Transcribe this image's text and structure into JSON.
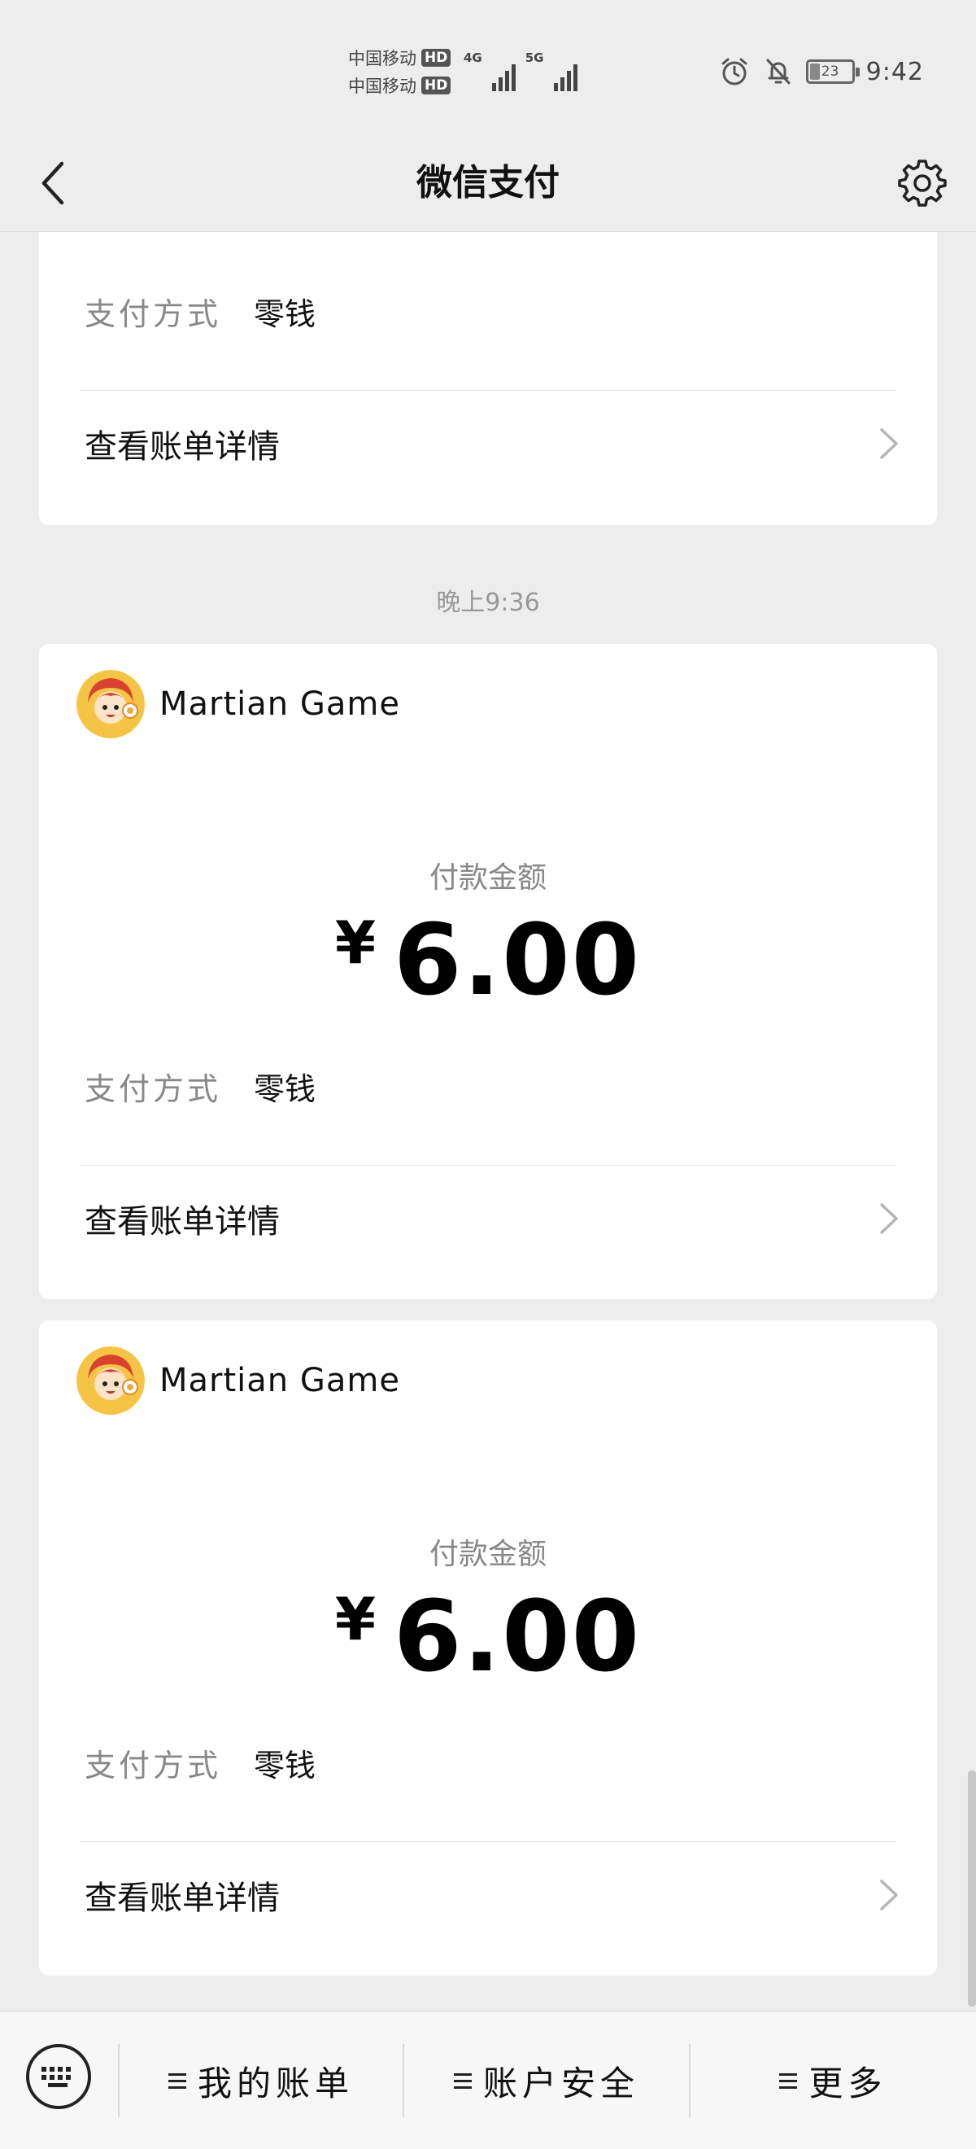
{
  "status_bar": {
    "carrier_1": "中国移动",
    "carrier_2": "中国移动",
    "hd_badge": "HD",
    "network_1": "4G",
    "network_2": "5G",
    "battery": "23",
    "time": "9:42",
    "icons": [
      "alarm-icon",
      "mute-bell-icon",
      "battery-icon"
    ]
  },
  "nav": {
    "title": "微信支付",
    "back_icon": "chevron-left-icon",
    "settings_icon": "gear-icon"
  },
  "cards": [
    {
      "method_label": "支付方式",
      "method_value": "零钱",
      "detail_label": "查看账单详情"
    },
    {
      "merchant": "Martian Game",
      "amount_label": "付款金额",
      "currency": "¥",
      "amount": "6.00",
      "method_label": "支付方式",
      "method_value": "零钱",
      "detail_label": "查看账单详情"
    },
    {
      "merchant": "Martian Game",
      "amount_label": "付款金额",
      "currency": "¥",
      "amount": "6.00",
      "method_label": "支付方式",
      "method_value": "零钱",
      "detail_label": "查看账单详情"
    }
  ],
  "timestamp": "晚上9:36",
  "bottom_bar": {
    "keyboard_icon": "keyboard-icon",
    "items": [
      {
        "label": "我的账单"
      },
      {
        "label": "账户安全"
      },
      {
        "label": "更多"
      }
    ]
  },
  "colors": {
    "background": "#ededed",
    "card": "#ffffff",
    "muted_text": "#888888",
    "primary_text": "#111111"
  }
}
